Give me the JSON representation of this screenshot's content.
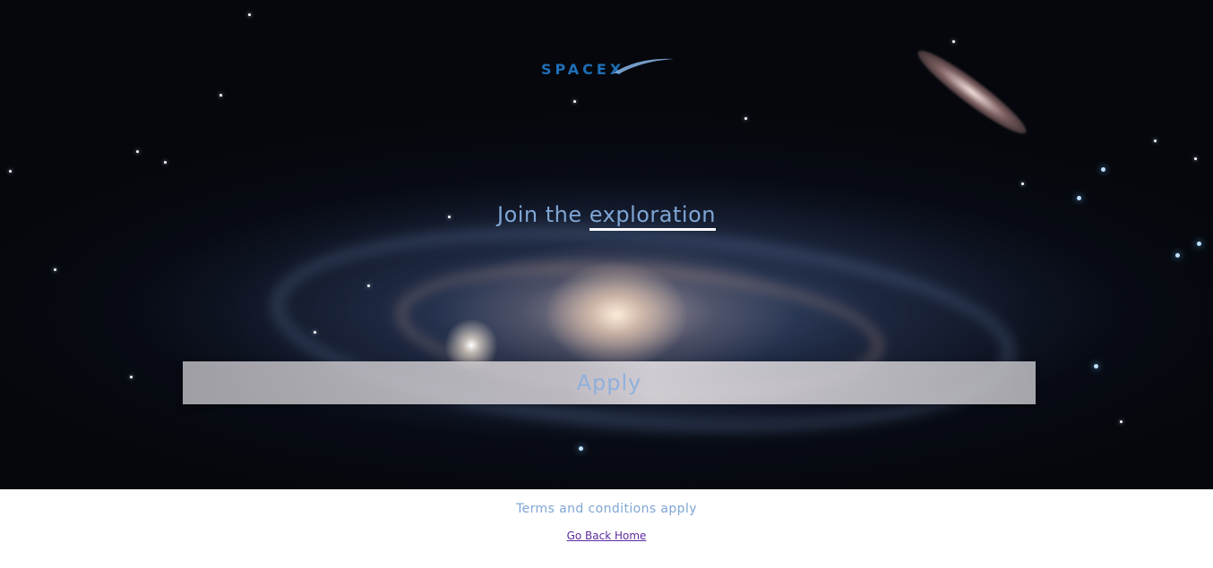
{
  "brand": {
    "logo_text": "SPACEX",
    "logo_color": "#1e6fb8"
  },
  "hero": {
    "headline_prefix": "Join the ",
    "headline_accent": "exploration",
    "apply_label": "Apply"
  },
  "footer": {
    "terms_text": "Terms and conditions apply",
    "home_link": "Go Back Home"
  },
  "colors": {
    "accent_text": "#7fa6d4",
    "link": "#5b2aa0",
    "background_space": "#05070c",
    "page_background": "#ffffff"
  }
}
